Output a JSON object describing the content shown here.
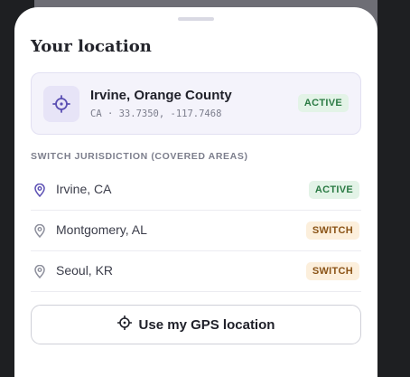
{
  "sheet": {
    "title": "Your location"
  },
  "current": {
    "name": "Irvine, Orange County",
    "coords": "CA · 33.7350, -117.7468",
    "badge": "ACTIVE",
    "icon": "crosshair-icon"
  },
  "section": {
    "label": "SWITCH JURISDICTION (COVERED AREAS)"
  },
  "jurisdictions": [
    {
      "label": "Irvine, CA",
      "badge": "ACTIVE",
      "status": "active",
      "icon": "map-pin-icon"
    },
    {
      "label": "Montgomery, AL",
      "badge": "SWITCH",
      "status": "switch",
      "icon": "map-pin-icon"
    },
    {
      "label": "Seoul, KR",
      "badge": "SWITCH",
      "status": "switch",
      "icon": "map-pin-icon"
    }
  ],
  "gps_button": {
    "label": "Use my GPS location",
    "icon": "crosshair-icon"
  },
  "colors": {
    "accent": "#5b4fb3",
    "active_badge_bg": "#e3f3e7",
    "active_badge_text": "#2a7a43",
    "switch_badge_bg": "#fcefdc",
    "switch_badge_text": "#8a5316"
  }
}
